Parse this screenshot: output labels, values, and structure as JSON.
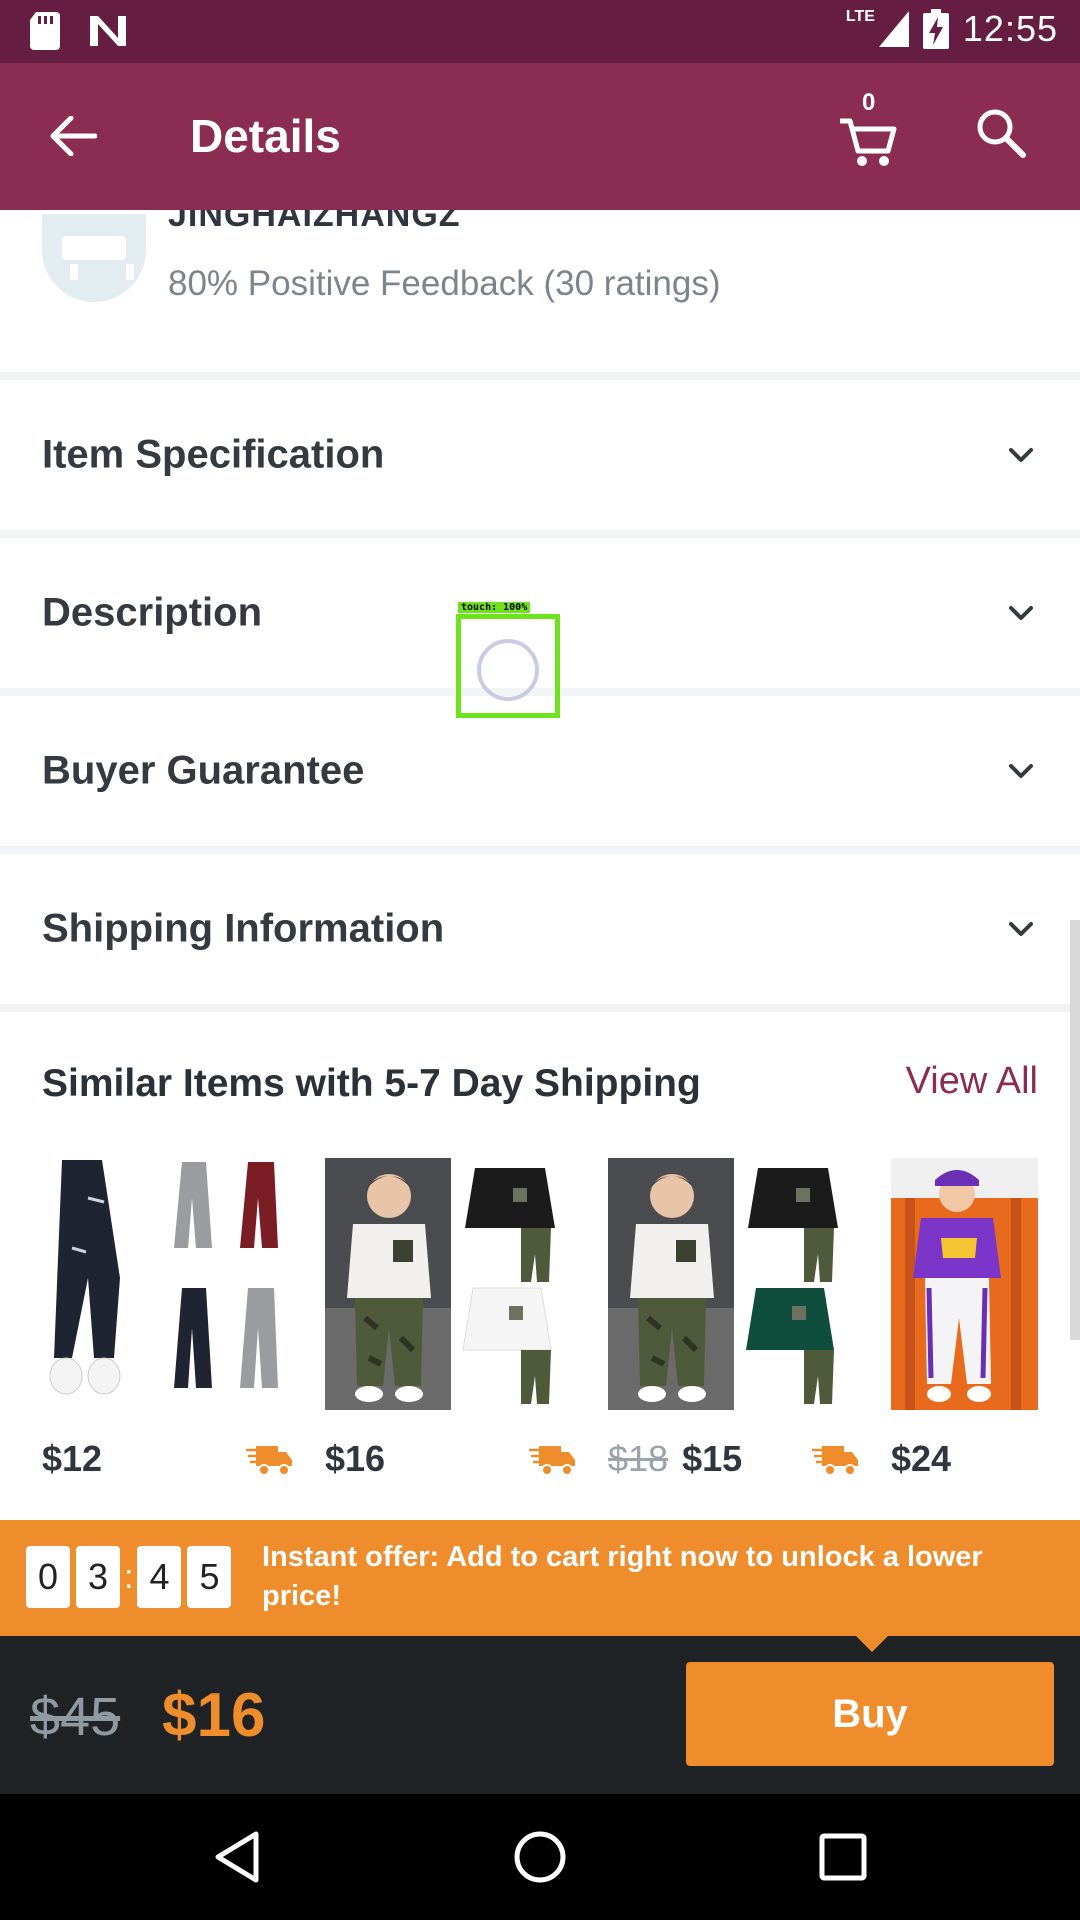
{
  "status_bar": {
    "network": "LTE",
    "time": "12:55"
  },
  "app_bar": {
    "title": "Details",
    "cart_count": "0"
  },
  "seller": {
    "name": "JINGHAIZHANGZ",
    "feedback": "80% Positive Feedback (30 ratings)"
  },
  "sections": [
    {
      "label": "Item Specification"
    },
    {
      "label": "Description"
    },
    {
      "label": "Buyer Guarantee"
    },
    {
      "label": "Shipping Information"
    }
  ],
  "similar": {
    "title": "Similar Items with 5-7 Day Shipping",
    "view_all": "View All",
    "items": [
      {
        "price": "$12",
        "old_price": "",
        "fast_shipping": true
      },
      {
        "price": "$16",
        "old_price": "",
        "fast_shipping": true
      },
      {
        "price": "$15",
        "old_price": "$18",
        "fast_shipping": true
      },
      {
        "price": "$24",
        "old_price": "",
        "fast_shipping": false
      }
    ]
  },
  "offer": {
    "timer": [
      "0",
      "3",
      "4",
      "5"
    ],
    "text": "Instant offer: Add to cart right now to unlock a lower price!"
  },
  "buy_bar": {
    "old_price": "$45",
    "price": "$16",
    "buy_label": "Buy"
  },
  "touch_overlay": {
    "label": "touch: 100%"
  },
  "colors": {
    "status_bar": "#651e42",
    "app_bar": "#8b2d52",
    "accent": "#ef8c2c",
    "buy_bar": "#1f2326"
  }
}
